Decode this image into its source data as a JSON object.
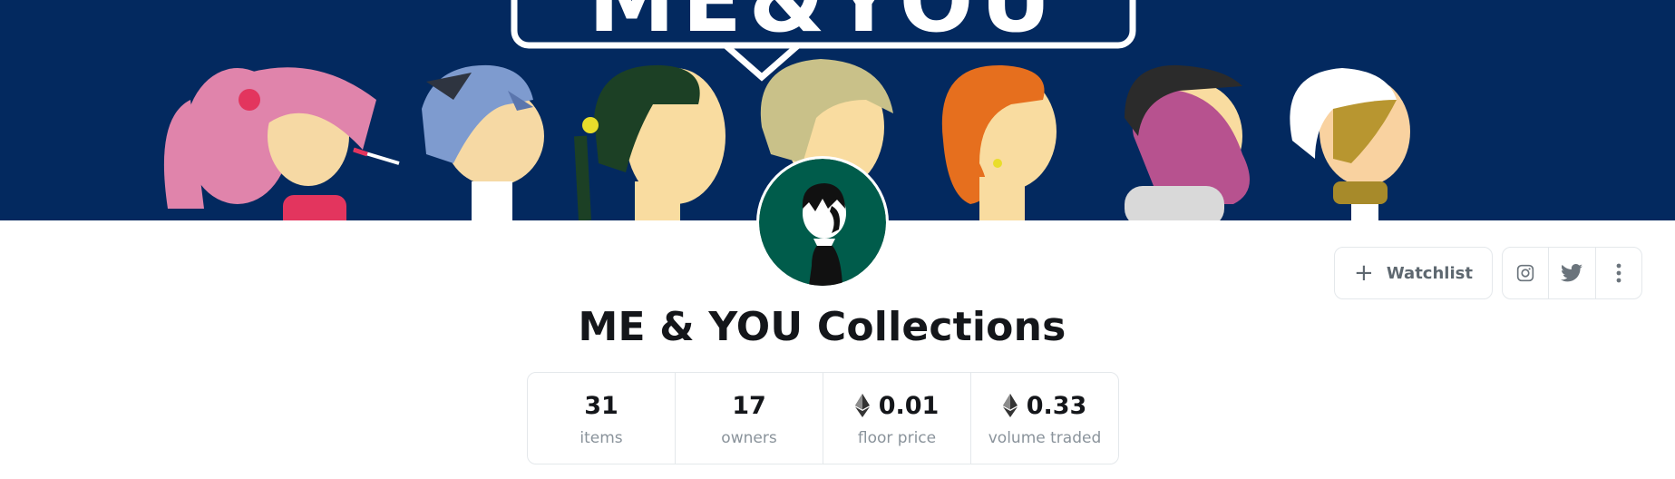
{
  "banner": {
    "logo_text": "ME&YOU",
    "background": "#03295f"
  },
  "avatar": {
    "background": "#005c4b"
  },
  "collection": {
    "title": "ME & YOU Collections"
  },
  "stats": [
    {
      "value": "31",
      "label": "items",
      "icon": ""
    },
    {
      "value": "17",
      "label": "owners",
      "icon": ""
    },
    {
      "value": "0.01",
      "label": "floor price",
      "icon": "ethereum-icon"
    },
    {
      "value": "0.33",
      "label": "volume traded",
      "icon": "ethereum-icon"
    }
  ],
  "actions": {
    "watchlist_label": "Watchlist",
    "watchlist_icon": "plus-icon"
  },
  "social": [
    {
      "icon": "instagram-icon"
    },
    {
      "icon": "twitter-icon"
    },
    {
      "icon": "more-vertical-icon"
    }
  ],
  "colors": {
    "text": "#14161a",
    "muted": "#8a939b",
    "border": "#e4e8eb"
  }
}
